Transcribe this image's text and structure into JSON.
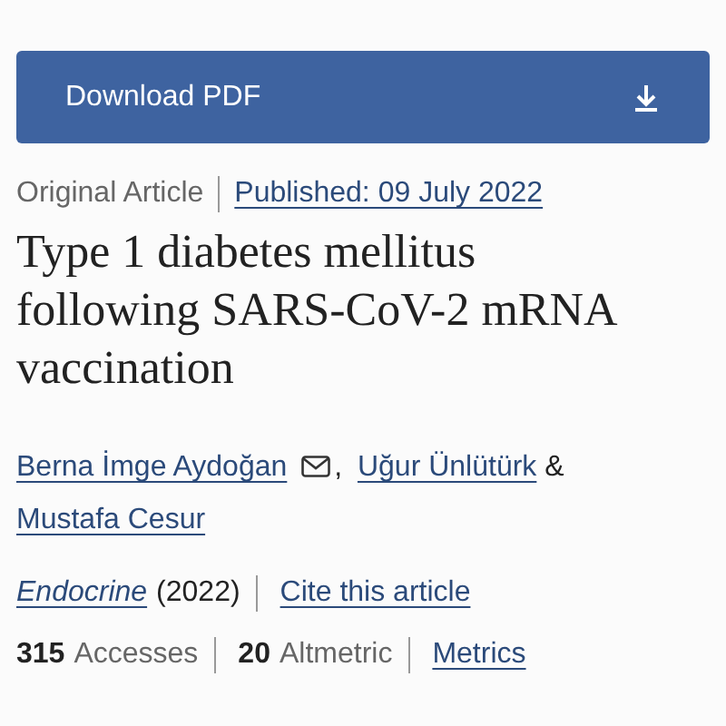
{
  "download_button": {
    "label": "Download PDF"
  },
  "meta": {
    "type": "Original Article",
    "published": "Published: 09 July 2022"
  },
  "title": "Type 1 diabetes mellitus following SARS-CoV-2 mRNA vaccination",
  "authors": [
    {
      "name": "Berna İmge Aydoğan",
      "email": true,
      "separator": ","
    },
    {
      "name": "Uğur Ünlütürk",
      "email": false,
      "separator": "&"
    },
    {
      "name": "Mustafa Cesur",
      "email": false
    }
  ],
  "journal": {
    "name": "Endocrine",
    "year": "(2022)",
    "cite": "Cite this article"
  },
  "metrics": [
    {
      "count": "315",
      "name": "Accesses"
    },
    {
      "count": "20",
      "name": "Altmetric"
    }
  ],
  "metrics_link": "Metrics"
}
